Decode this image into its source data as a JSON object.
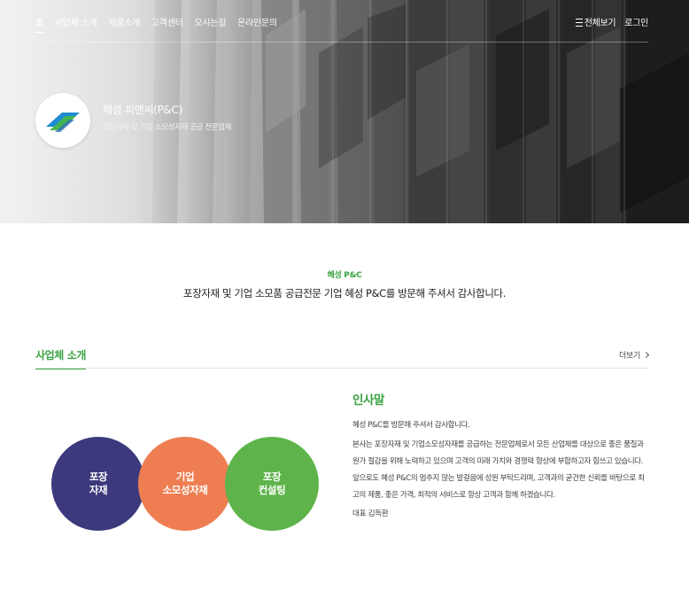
{
  "nav": {
    "items": [
      "홈",
      "사업체 소개",
      "제품소개",
      "고객센터",
      "오시는길",
      "온라인문의"
    ],
    "all_view": "전체보기",
    "login": "로그인"
  },
  "brand": {
    "name": "혜성 피앤씨(P&C)",
    "subtitle": "포장자재 및 기업 소모성자재 공급 전문업체"
  },
  "welcome": {
    "kicker": "혜성 P&C",
    "text": "포장자재 및 기업 소모품 공급전문 기업 혜성 P&C를 방문해 주셔서 감사합니다."
  },
  "section": {
    "title": "사업체 소개",
    "more": "더보기"
  },
  "circles": [
    {
      "label": "포장\n자재",
      "color": "#3c3a7c"
    },
    {
      "label": "기업\n소모성자재",
      "color": "#ee7e52"
    },
    {
      "label": "포장\n컨설팅",
      "color": "#5eb44a"
    }
  ],
  "greeting": {
    "title": "인사말",
    "intro": "혜성 P&C를 방문해 주셔서 감사합니다.",
    "body": "본사는 포장자재 및 기업소모성자재를 공급하는 전문업체로서 모든 산업체를 대상으로 좋은 품질과 원가 절감을 위해 노력하고 있으며 고객의 미래 가치와 경쟁력 향상에 부합하고자 힘쓰고 있습니다. 앞으로도 혜성 P&C의 멈추지 않는 발걸음에 성원 부탁드리며, 고객과의 굳건한 신뢰를 바탕으로 최고의 제품, 좋은 가격, 최적의 서비스로 항상 고객과 함께 하겠습니다.",
    "signature": "대표 김득환"
  },
  "colors": {
    "accent": "#3aa441",
    "navy": "#3c3a7c",
    "orange": "#ee7e52",
    "green": "#5eb44a"
  }
}
